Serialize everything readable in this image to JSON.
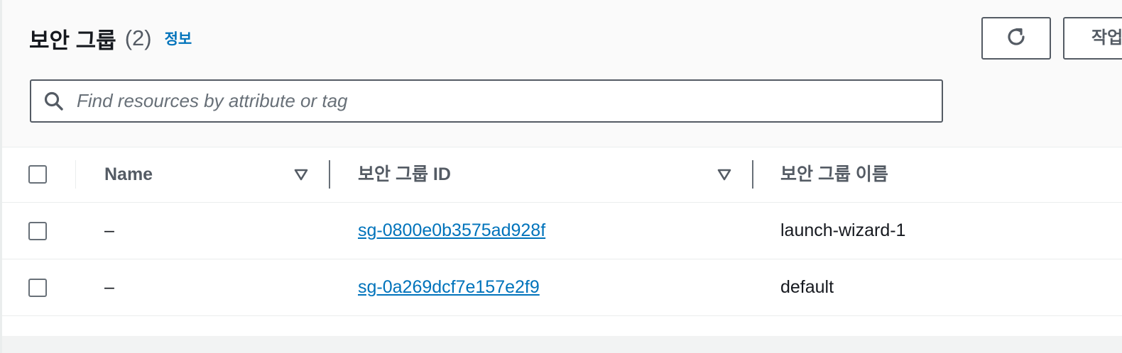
{
  "header": {
    "title": "보안 그룹",
    "count": "(2)",
    "info_link": "정보",
    "refresh_icon": "refresh-icon",
    "actions_label": "작업"
  },
  "search": {
    "placeholder": "Find resources by attribute or tag",
    "value": "",
    "icon": "search-icon"
  },
  "table": {
    "columns": [
      {
        "label": "Name"
      },
      {
        "label": "보안 그룹 ID"
      },
      {
        "label": "보안 그룹 이름"
      }
    ],
    "rows": [
      {
        "name": "–",
        "group_id": "sg-0800e0b3575ad928f",
        "group_name": "launch-wizard-1"
      },
      {
        "name": "–",
        "group_id": "sg-0a269dcf7e157e2f9",
        "group_name": "default"
      }
    ]
  },
  "colors": {
    "link": "#0073bb",
    "text": "#16191f",
    "muted": "#545b64",
    "border": "#eaeded",
    "header_bg": "#fafafa"
  }
}
